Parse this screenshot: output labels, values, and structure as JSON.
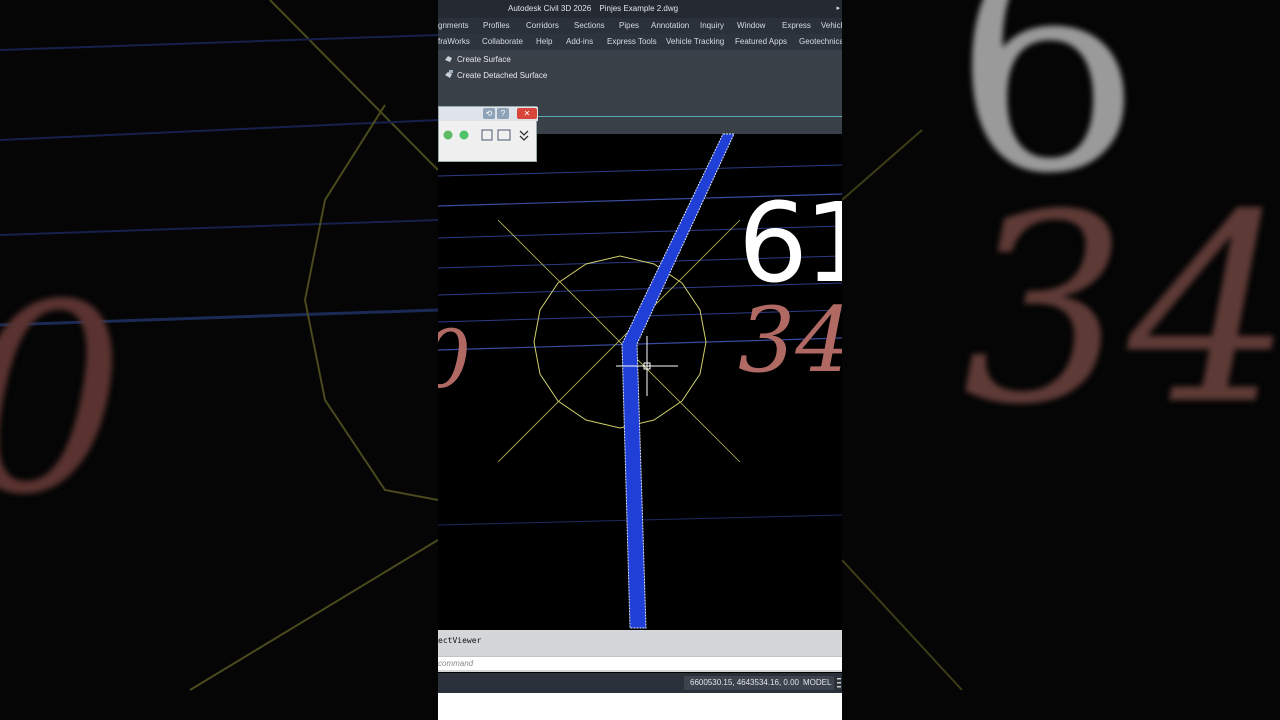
{
  "window": {
    "app_name": "Autodesk Civil 3D 2026",
    "file_name": "Pinjes Example 2.dwg"
  },
  "ribbon_tabs_row1": [
    "gnments",
    "Profiles",
    "Corridors",
    "Sections",
    "Pipes",
    "Annotation",
    "Inquiry",
    "Window",
    "Express",
    "Vehicl"
  ],
  "ribbon_tabs_row2": [
    "fraWorks",
    "Collaborate",
    "Help",
    "Add-ins",
    "Express Tools",
    "Vehicle Tracking",
    "Featured Apps",
    "Geotechnica"
  ],
  "dropdown": {
    "items": [
      "Create Surface",
      "Create Detached Surface"
    ]
  },
  "drawing": {
    "label_large": "61",
    "label_red": "34",
    "label_red_left": "0",
    "colors": {
      "polyline": "#1f3fd6",
      "grid_lines": "#3a4a9c",
      "circle": "#cfcf6a",
      "red_text": "#b06a63"
    }
  },
  "side_text": {
    "right_big": "6",
    "right_red": "34",
    "left_red": "0"
  },
  "command": {
    "history": "ectViewer",
    "placeholder": "command"
  },
  "status_bar": {
    "coordinates": "6600530.15, 4643534.16, 0.00",
    "space": "MODEL"
  }
}
